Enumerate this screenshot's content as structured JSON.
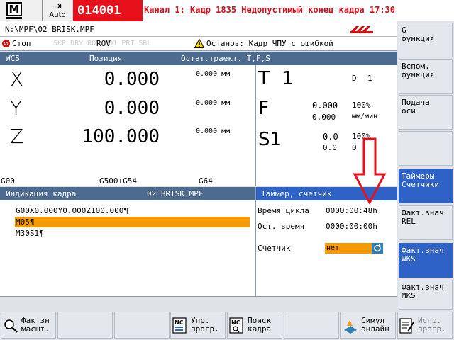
{
  "header": {
    "mode_icon": "M",
    "mode_label": "Auto",
    "alarm_number": "014001",
    "alarm_text": "Канал 1: Кадр 1835 Недопустимый конец кадра 17:30",
    "program_path": "N:\\MPF\\02 BRISK.MPF"
  },
  "status": {
    "stop_label": "Стоп",
    "grey_modes": "SKP DRY  ROV M01 PRT SBL",
    "rov_label": "ROV",
    "stop_reason": "Останов: Кадр ЧПУ с ошибкой"
  },
  "position_panel": {
    "headers": {
      "wcs": "WCS",
      "position": "Позиция",
      "rest": "Остат.траект. T,F,S"
    },
    "axes": [
      {
        "name": "X",
        "value": "0.000",
        "rest": "0.000 мм"
      },
      {
        "name": "Y",
        "value": "0.000",
        "rest": "0.000 мм"
      },
      {
        "name": "Z",
        "value": "100.000",
        "rest": "0.000 мм"
      }
    ],
    "gcodes": [
      "G00",
      "G500+G54",
      "G64"
    ]
  },
  "tfs": {
    "t_letter": "T",
    "t_value": "1",
    "d_label": "D",
    "d_value": "1",
    "f_letter": "F",
    "f_value": "0.000",
    "f_value2": "0.000",
    "f_percent": "100%",
    "f_unit": "мм/мин",
    "s_letter": "S1",
    "s_value": "0.0",
    "s_value2": "0.0",
    "s_percent": "100%",
    "s_value3": "0"
  },
  "block_display": {
    "title": "Индикация кадра",
    "file": "02 BRISK.MPF",
    "lines": [
      "G00X0.000Y0.000Z100.000¶",
      "M05¶",
      "M30S1¶"
    ]
  },
  "timer": {
    "title": "Таймер, счетчик",
    "cycle_label": "Время цикла",
    "cycle_value": "0000:00:48h",
    "remain_label": "Ост. время",
    "remain_value": "0000:00:00h",
    "counter_label": "Счетчик",
    "counter_value": "нет"
  },
  "vertical_softkeys": [
    {
      "label": "G\nфункция",
      "active": false
    },
    {
      "label": "Вспом.\nфункция",
      "active": false
    },
    {
      "label": "Подача\nоси",
      "active": false
    },
    {
      "label": "",
      "active": false
    },
    {
      "label": "Таймеры\nСчетчики",
      "active": true
    },
    {
      "label": "Факт.знач\nREL",
      "active": false
    },
    {
      "label": "Факт.знач\nWKS",
      "active": true
    },
    {
      "label": "Факт.знач\nMKS",
      "active": false
    }
  ],
  "horizontal_softkeys": [
    {
      "label": "Фак зн\nмасшт.",
      "icon": "zoom-icon"
    },
    {
      "label": "",
      "icon": ""
    },
    {
      "label": "",
      "icon": ""
    },
    {
      "label": "Упр.\nпрогр.",
      "icon": "nc-icon"
    },
    {
      "label": "Поиск\nкадра",
      "icon": "nc-search-icon"
    },
    {
      "label": "",
      "icon": ""
    },
    {
      "label": "Симул\nонлайн",
      "icon": "simulation-icon"
    },
    {
      "label": "Испр.\nпрогр.",
      "icon": "edit-program-icon"
    }
  ],
  "colors": {
    "alarm_red": "#e8101a",
    "header_blue": "#4d6b8f",
    "active_blue": "#2e62c6",
    "highlight_orange": "#f59a00"
  }
}
